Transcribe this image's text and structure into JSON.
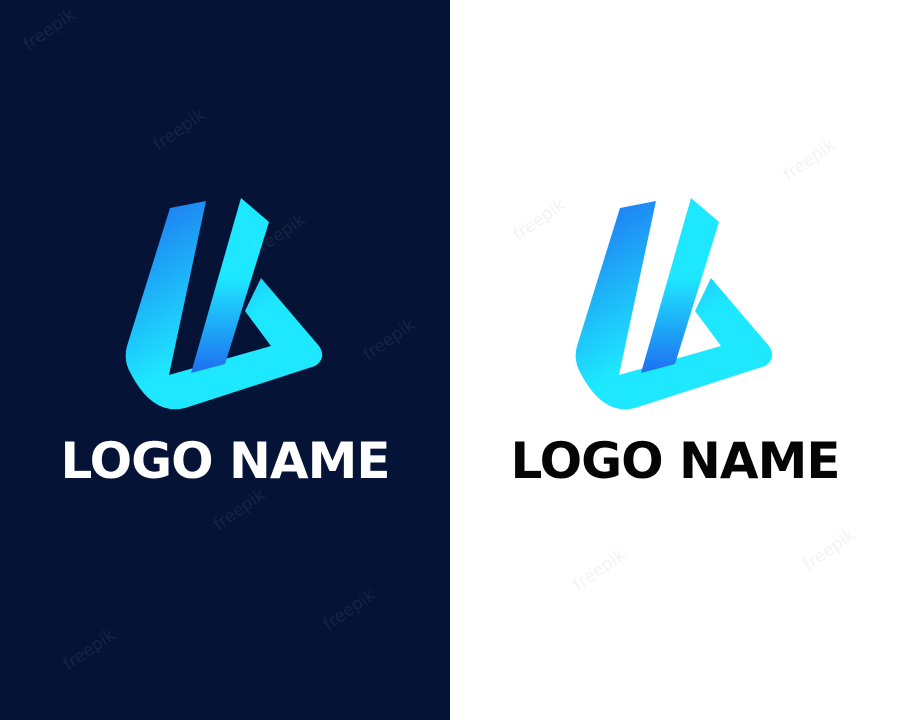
{
  "panels": [
    {
      "variant": "dark",
      "background": "#051436",
      "text_color": "#ffffff",
      "logo_name": "LOGO NAME"
    },
    {
      "variant": "light",
      "background": "#ffffff",
      "text_color": "#050505",
      "logo_name": "LOGO NAME"
    }
  ],
  "logo": {
    "gradient_start": "#1e6ff0",
    "gradient_end": "#1ee8ff"
  },
  "watermark": "freepik"
}
